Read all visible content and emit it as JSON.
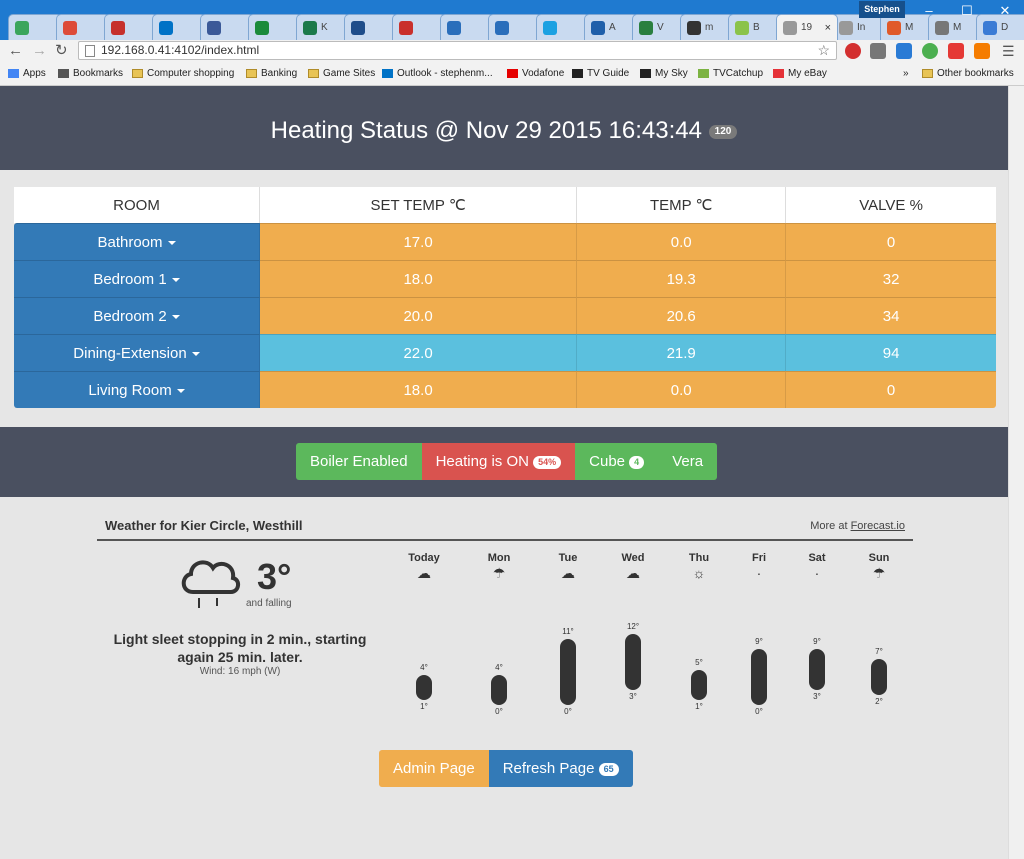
{
  "browser": {
    "tabs": [
      {
        "label": "",
        "color": "#3aa55c"
      },
      {
        "label": "",
        "color": "#dd4b39"
      },
      {
        "label": "",
        "color": "#c6302c"
      },
      {
        "label": "",
        "color": "#0072c6"
      },
      {
        "label": "",
        "color": "#3b5998"
      },
      {
        "label": "",
        "color": "#1b8b3b"
      },
      {
        "label": "K",
        "color": "#1b7a4b"
      },
      {
        "label": "",
        "color": "#1f4d8a"
      },
      {
        "label": "",
        "color": "#c9302c"
      },
      {
        "label": "",
        "color": "#2a6ebb"
      },
      {
        "label": "",
        "color": "#2a6ebb"
      },
      {
        "label": "",
        "color": "#1ba1e2"
      },
      {
        "label": "A",
        "color": "#1f5faa"
      },
      {
        "label": "V",
        "color": "#2a7f3f"
      },
      {
        "label": "m",
        "color": "#333333"
      },
      {
        "label": "B",
        "color": "#8bc34a"
      },
      {
        "label": "19",
        "color": "#999999"
      },
      {
        "label": "In",
        "color": "#999999"
      },
      {
        "label": "M",
        "color": "#e05a2a"
      },
      {
        "label": "M",
        "color": "#777777"
      },
      {
        "label": "D",
        "color": "#3a7bd5"
      }
    ],
    "profile_name": "Stephen",
    "address": "192.168.0.41:4102/index.html",
    "bookmarks": [
      {
        "label": "Apps",
        "icon": "apps-icon"
      },
      {
        "label": "Bookmarks",
        "icon": "star-icon"
      },
      {
        "label": "Computer shopping",
        "icon": "folder-icon"
      },
      {
        "label": "Banking",
        "icon": "folder-icon"
      },
      {
        "label": "Game Sites",
        "icon": "folder-icon"
      },
      {
        "label": "Outlook - stephenm...",
        "icon": "outlook-icon"
      },
      {
        "label": "Vodafone",
        "icon": "vodafone-icon"
      },
      {
        "label": "TV Guide",
        "icon": "sky-icon"
      },
      {
        "label": "My Sky",
        "icon": "sky-icon"
      },
      {
        "label": "TVCatchup",
        "icon": "play-icon"
      },
      {
        "label": "My eBay",
        "icon": "ebay-icon"
      }
    ],
    "overflow": "»",
    "other_bookmarks": "Other bookmarks"
  },
  "page": {
    "title": "Heating Status @ Nov 29 2015 16:43:44",
    "title_badge": "120",
    "table": {
      "headers": [
        "ROOM",
        "SET TEMP ℃",
        "TEMP ℃",
        "VALVE %"
      ],
      "rows": [
        {
          "room": "Bathroom",
          "set": "17.0",
          "temp": "0.0",
          "valve": "0",
          "color": "#f0ad4e"
        },
        {
          "room": "Bedroom 1",
          "set": "18.0",
          "temp": "19.3",
          "valve": "32",
          "color": "#f0ad4e"
        },
        {
          "room": "Bedroom 2",
          "set": "20.0",
          "temp": "20.6",
          "valve": "34",
          "color": "#f0ad4e"
        },
        {
          "room": "Dining-Extension",
          "set": "22.0",
          "temp": "21.9",
          "valve": "94",
          "color": "#5bc0de"
        },
        {
          "room": "Living Room",
          "set": "18.0",
          "temp": "0.0",
          "valve": "0",
          "color": "#f0ad4e"
        }
      ]
    },
    "controls": {
      "boiler": "Boiler Enabled",
      "heating": "Heating is ON",
      "heating_badge": "54%",
      "cube": "Cube",
      "cube_badge": "4",
      "vera": "Vera"
    },
    "weather": {
      "title": "Weather for Kier Circle, Westhill",
      "more_prefix": "More at ",
      "more_link": "Forecast.io",
      "current_temp": "3°",
      "current_trend": "and falling",
      "summary": "Light sleet stopping in 2 min., starting again 25 min. later.",
      "wind": "Wind: 16 mph (W)",
      "days": [
        {
          "name": "Today",
          "icon": "☁",
          "high": "4°",
          "low": "1°",
          "high_val": 4,
          "low_val": 1
        },
        {
          "name": "Mon",
          "icon": "☂",
          "high": "4°",
          "low": "0°",
          "high_val": 4,
          "low_val": 0
        },
        {
          "name": "Tue",
          "icon": "☁",
          "high": "11°",
          "low": "0°",
          "high_val": 11,
          "low_val": 0
        },
        {
          "name": "Wed",
          "icon": "☁",
          "high": "12°",
          "low": "3°",
          "high_val": 12,
          "low_val": 3
        },
        {
          "name": "Thu",
          "icon": "☼",
          "high": "5°",
          "low": "1°",
          "high_val": 5,
          "low_val": 1
        },
        {
          "name": "Fri",
          "icon": "·",
          "high": "9°",
          "low": "0°",
          "high_val": 9,
          "low_val": 0
        },
        {
          "name": "Sat",
          "icon": "·",
          "high": "9°",
          "low": "3°",
          "high_val": 9,
          "low_val": 3
        },
        {
          "name": "Sun",
          "icon": "☂",
          "high": "7°",
          "low": "2°",
          "high_val": 7,
          "low_val": 2
        }
      ]
    },
    "buttons": {
      "admin": "Admin Page",
      "refresh": "Refresh Page",
      "refresh_badge": "65"
    }
  },
  "colors": {
    "header_bg": "#4a5060",
    "room_blue": "#337ab7",
    "warning": "#f0ad4e",
    "info": "#5bc0de",
    "success": "#5cb85c",
    "danger": "#d9534f"
  }
}
